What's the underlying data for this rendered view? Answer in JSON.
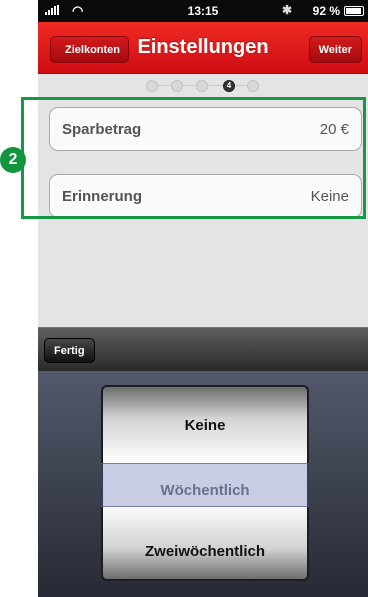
{
  "status_bar": {
    "time": "13:15",
    "battery": "92 %"
  },
  "nav": {
    "back_label": "Zielkonten",
    "title": "Einstellungen",
    "next_label": "Weiter"
  },
  "steps": {
    "total": 5,
    "current": 4,
    "current_label": "4"
  },
  "annotation": {
    "badge": "2",
    "color": "#129a44"
  },
  "form": {
    "sparbetrag": {
      "label": "Sparbetrag",
      "value": "20  €"
    },
    "erinnerung": {
      "label": "Erinnerung",
      "value": "Keine"
    }
  },
  "toolbar": {
    "done_label": "Fertig"
  },
  "picker": {
    "options": [
      "Keine",
      "Wöchentlich",
      "Zweiwöchentlich"
    ],
    "highlighted": "Wöchentlich"
  },
  "colors": {
    "brand_red": "#e01b1c",
    "annotation_green": "#129a44"
  }
}
